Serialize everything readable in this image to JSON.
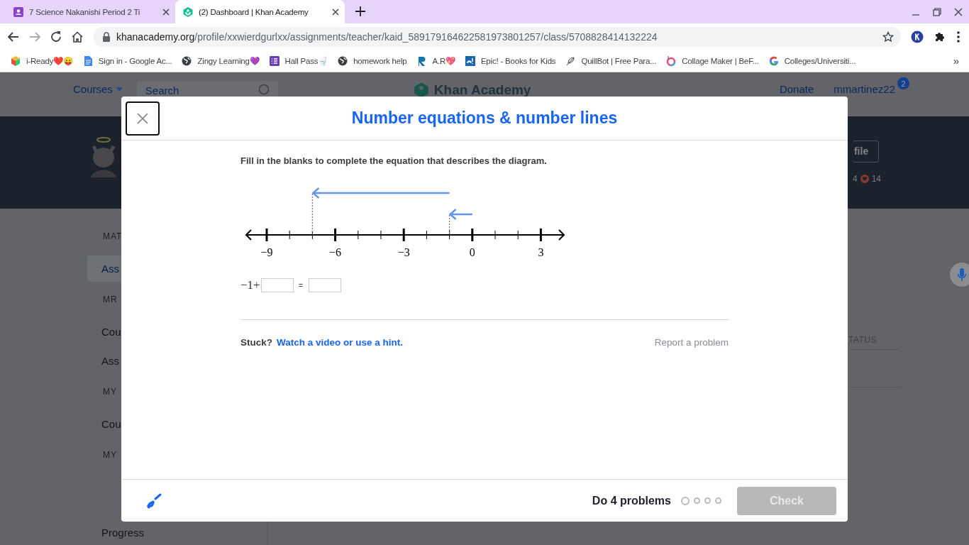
{
  "browser": {
    "tabs": [
      {
        "title": "7 Science Nakanishi Period 2 Ti",
        "kind": "classroom",
        "selected": false
      },
      {
        "title": "(2) Dashboard | Khan Academy",
        "kind": "khan",
        "selected": true
      }
    ],
    "address_bar": {
      "domain": "khanacademy.org",
      "path": "/profile/xxwierdgurlxx/assignments/teacher/kaid_589179164622581973801257/class/5708828414132224"
    },
    "bookmarks": [
      {
        "label": "i-Ready❤️😛",
        "kind": "cube"
      },
      {
        "label": "Sign in - Google Ac...",
        "kind": "doc"
      },
      {
        "label": "Zingy Learning💜",
        "kind": "globe"
      },
      {
        "label": "Hall Pass🚽",
        "kind": "list"
      },
      {
        "label": "homework help",
        "kind": "globe"
      },
      {
        "label": "A.R💖",
        "kind": "letter-r"
      },
      {
        "label": "Epic! - Books for Kids",
        "kind": "epic"
      },
      {
        "label": "QuillBot | Free Para...",
        "kind": "feather"
      },
      {
        "label": "Collage Maker | BeF...",
        "kind": "ring"
      },
      {
        "label": "Colleges/Universiti...",
        "kind": "google"
      }
    ],
    "bookmarks_overflow": "»"
  },
  "background_page": {
    "nav": {
      "courses": "Courses",
      "search_placeholder": "Search",
      "logo": "Khan Academy",
      "donate": "Donate",
      "user": "mmartinez22",
      "notifications": "2"
    },
    "profile": {
      "button": "file",
      "stat_1": "4",
      "stat_2": "14"
    },
    "sidebar": [
      {
        "heading": "MAT",
        "items": [
          {
            "label": "Ass",
            "selected": true
          }
        ]
      },
      {
        "heading": "MR",
        "items": [
          {
            "label": "Cou",
            "selected": false
          },
          {
            "label": "Ass",
            "selected": false
          }
        ]
      },
      {
        "heading": "MY",
        "items": [
          {
            "label": "Cou",
            "selected": false
          }
        ]
      },
      {
        "heading": "MY",
        "items": [
          {
            "label": "Progress",
            "selected": false
          }
        ]
      }
    ],
    "table_header": "TATUS"
  },
  "exercise": {
    "title": "Number equations & number lines",
    "instruction": "Fill in the blanks to complete the equation that describes the diagram.",
    "number_line": {
      "labels": [
        "−9",
        "−6",
        "−3",
        "0",
        "3"
      ]
    },
    "equation": {
      "prefix": "−1+",
      "equals": "="
    },
    "stuck": "Stuck?",
    "hint_link": "Watch a video or use a hint.",
    "report": "Report a problem",
    "footer": {
      "goal": "Do 4 problems",
      "progress": [
        {
          "current": true
        },
        {
          "current": false
        },
        {
          "current": false
        },
        {
          "current": false
        }
      ],
      "check": {
        "label": "Check",
        "disabled": true
      }
    }
  }
}
